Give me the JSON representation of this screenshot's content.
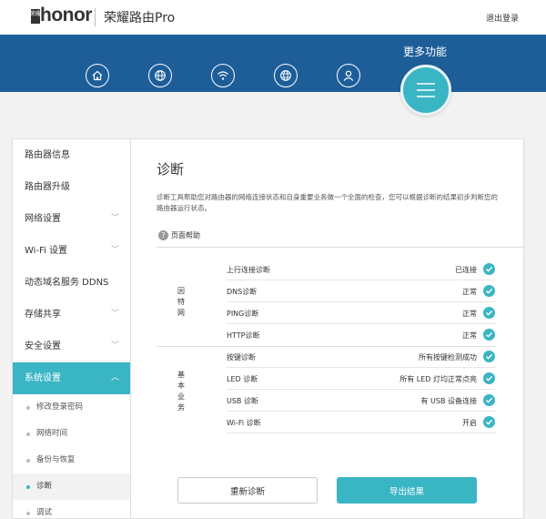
{
  "header": {
    "brand_cn": "荣耀",
    "brand": "honor",
    "product": "荣耀路由Pro",
    "logout": "退出登录"
  },
  "nav": {
    "icons": [
      "home-icon",
      "globe-icon",
      "wifi-icon",
      "globe-network-icon",
      "user-icon"
    ],
    "more_label": "更多功能",
    "more_icon": "menu-icon"
  },
  "sidebar": {
    "items": [
      {
        "label": "路由器信息",
        "chevron": false
      },
      {
        "label": "路由器升级",
        "chevron": false
      },
      {
        "label": "网络设置",
        "chevron": true
      },
      {
        "label": "Wi-Fi 设置",
        "chevron": true
      },
      {
        "label": "动态域名服务 DDNS",
        "chevron": false
      },
      {
        "label": "存储共享",
        "chevron": true
      },
      {
        "label": "安全设置",
        "chevron": true
      },
      {
        "label": "系统设置",
        "chevron": true,
        "active": true
      }
    ],
    "sub_items": [
      "修改登录密码",
      "网络时间",
      "备份与恢复",
      "诊断",
      "调试"
    ],
    "selected_sub": "诊断"
  },
  "main": {
    "title": "诊断",
    "description": "诊断工具帮助您对路由器的网络连接状态和自身重要业务做一个全面的检查，您可以根据诊断的结果初步判断您的路由器运行状态。",
    "help": "页面帮助",
    "groups": [
      {
        "label": "因特网",
        "rows": [
          {
            "name": "上行连接诊断",
            "status": "已连接"
          },
          {
            "name": "DNS诊断",
            "status": "正常"
          },
          {
            "name": "PING诊断",
            "status": "正常"
          },
          {
            "name": "HTTP诊断",
            "status": "正常"
          }
        ]
      },
      {
        "label": "基本业务",
        "rows": [
          {
            "name": "按键诊断",
            "status": "所有按键检测成功"
          },
          {
            "name": "LED 诊断",
            "status": "所有 LED 灯均正常点亮"
          },
          {
            "name": "USB 诊断",
            "status": "有 USB 设备连接"
          },
          {
            "name": "Wi-Fi 诊断",
            "status": "开启"
          }
        ]
      }
    ],
    "rediagnose": "重新诊断",
    "export": "导出结果"
  },
  "colors": {
    "accent": "#3ab5c4",
    "banner": "#1d5e99"
  }
}
